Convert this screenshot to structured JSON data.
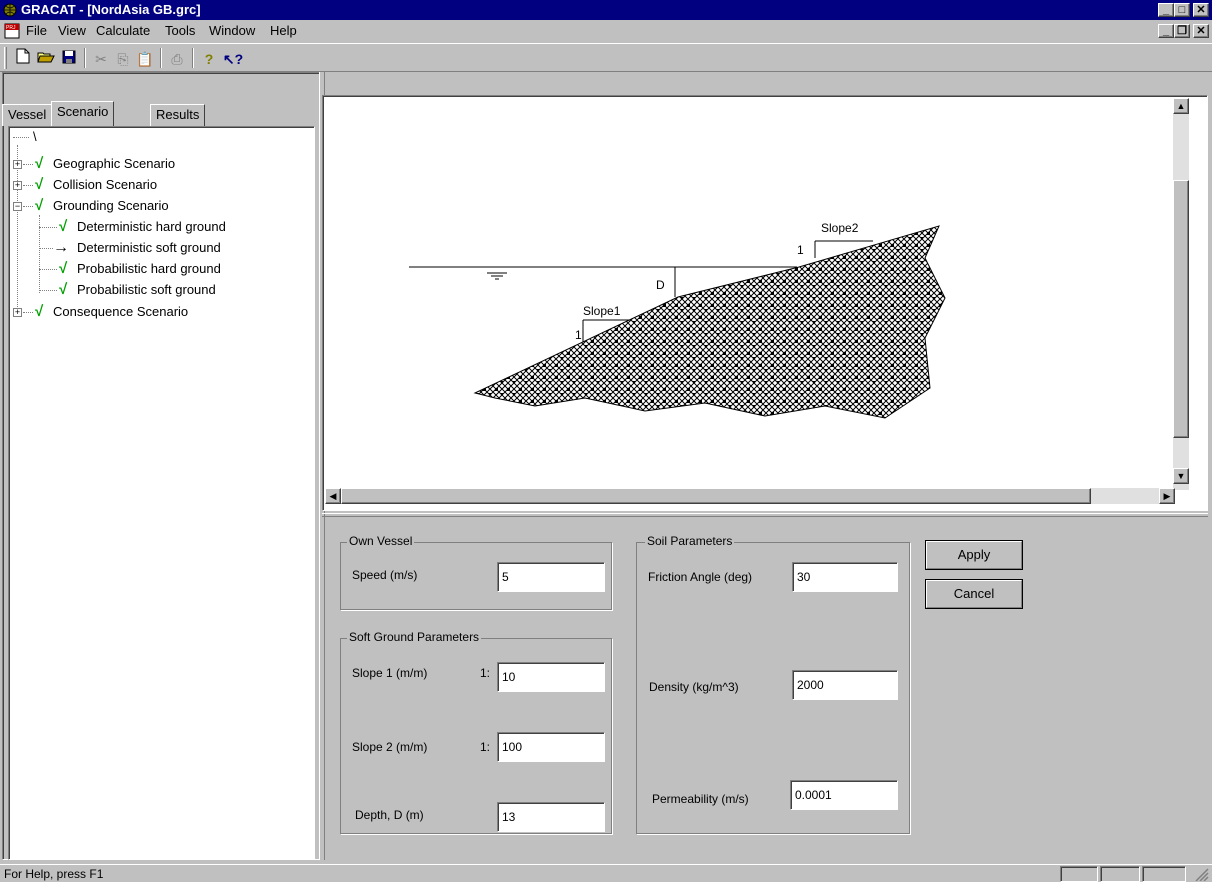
{
  "window": {
    "title": "GRACAT - [NordAsia GB.grc]",
    "app_icon": "globe-icon"
  },
  "menu": {
    "items": [
      "File",
      "View",
      "Calculate",
      "Tools",
      "Window",
      "Help"
    ],
    "doc_icon": "PRJ"
  },
  "toolbar": {
    "buttons": [
      "new-icon",
      "open-icon",
      "save-icon",
      "cut-icon",
      "copy-icon",
      "paste-icon",
      "print-icon",
      "help-icon",
      "context-help-icon"
    ]
  },
  "tabs": [
    "Vessel",
    "Scenario",
    "Results"
  ],
  "tree": {
    "root": "\\",
    "nodes": [
      {
        "label": "Geographic Scenario"
      },
      {
        "label": "Collision Scenario"
      },
      {
        "label": "Grounding Scenario"
      },
      {
        "label": "Deterministic hard ground"
      },
      {
        "label": "Deterministic soft ground"
      },
      {
        "label": "Probabilistic hard ground"
      },
      {
        "label": "Probabilistic soft ground"
      },
      {
        "label": "Consequence Scenario"
      }
    ]
  },
  "diagram": {
    "slope1": "Slope1",
    "slope2": "Slope2",
    "one": "1",
    "depth": "D"
  },
  "own_vessel": {
    "title": "Own Vessel",
    "speed_label": "Speed (m/s)",
    "speed": "5"
  },
  "soft_ground": {
    "title": "Soft Ground Parameters",
    "slope1_label": "Slope 1 (m/m)",
    "slope1_prefix": "1:",
    "slope1": "10",
    "slope2_label": "Slope 2 (m/m)",
    "slope2_prefix": "1:",
    "slope2": "100",
    "depth_label": "Depth, D (m)",
    "depth": "13"
  },
  "soil": {
    "title": "Soil Parameters",
    "friction_label": "Friction Angle (deg)",
    "friction": "30",
    "density_label": "Density (kg/m^3)",
    "density": "2000",
    "permeability_label": "Permeability (m/s)",
    "permeability": "0.0001"
  },
  "buttons": {
    "apply": "Apply",
    "cancel": "Cancel"
  },
  "status": {
    "text": "For Help, press F1"
  }
}
